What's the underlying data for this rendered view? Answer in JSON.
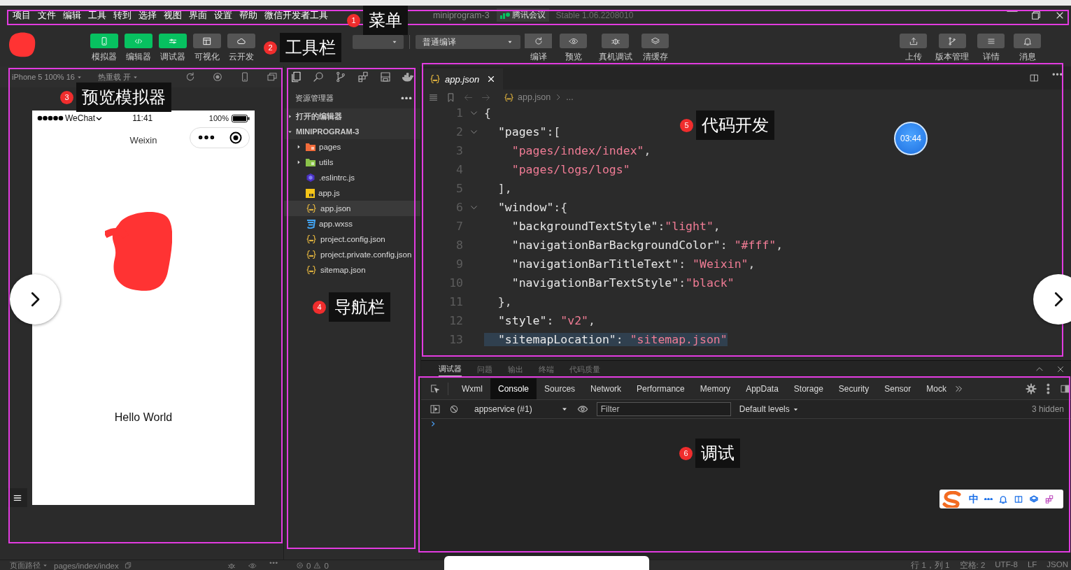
{
  "menu_bar": {
    "items": [
      "项目",
      "文件",
      "编辑",
      "工具",
      "转到",
      "选择",
      "视图",
      "界面",
      "设置",
      "帮助",
      "微信开发者工具"
    ],
    "title": "miniprogram-3",
    "overlay_app": "腾讯会议",
    "version": "Stable 1.06.2208010"
  },
  "toolbar": {
    "view_buttons": [
      {
        "label": "模拟器",
        "on": true,
        "kind": "phone"
      },
      {
        "label": "编辑器",
        "on": true,
        "kind": "code"
      },
      {
        "label": "调试器",
        "on": true,
        "kind": "sliders"
      },
      {
        "label": "可视化",
        "on": false,
        "kind": "layout"
      },
      {
        "label": "云开发",
        "on": false,
        "kind": "cloud"
      }
    ],
    "compile_mode": "普通编译",
    "actions": [
      {
        "label": "编译",
        "kind": "refresh"
      },
      {
        "label": "预览",
        "kind": "eye"
      },
      {
        "label": "真机调试",
        "kind": "bug"
      },
      {
        "label": "清缓存",
        "kind": "layers"
      }
    ],
    "right_actions": [
      {
        "label": "上传",
        "kind": "upload"
      },
      {
        "label": "版本管理",
        "kind": "branch"
      },
      {
        "label": "详情",
        "kind": "menu"
      },
      {
        "label": "消息",
        "kind": "bell"
      }
    ]
  },
  "simulator": {
    "device": "iPhone 5 100% 16",
    "hot_reload": "热重载 开",
    "carrier": "WeChat",
    "time": "11:41",
    "battery": "100%",
    "nav_title": "Weixin",
    "body_text": "Hello World"
  },
  "explorer": {
    "title": "资源管理器",
    "sections": [
      {
        "label": "打开的编辑器",
        "expanded": false
      },
      {
        "label": "MINIPROGRAM-3",
        "expanded": true,
        "children": [
          {
            "name": "pages",
            "kind": "folder",
            "color": "#f26b3a",
            "expanded": false,
            "selected": false
          },
          {
            "name": "utils",
            "kind": "folder",
            "color": "#8bc34a",
            "expanded": false,
            "selected": false
          },
          {
            "name": ".eslintrc.js",
            "kind": "eslint",
            "selected": false
          },
          {
            "name": "app.js",
            "kind": "js",
            "selected": false
          },
          {
            "name": "app.json",
            "kind": "json",
            "selected": true
          },
          {
            "name": "app.wxss",
            "kind": "wxss",
            "selected": false
          },
          {
            "name": "project.config.json",
            "kind": "json",
            "selected": false
          },
          {
            "name": "project.private.config.json",
            "kind": "json",
            "selected": false
          },
          {
            "name": "sitemap.json",
            "kind": "json",
            "selected": false
          }
        ]
      }
    ]
  },
  "editor": {
    "tab": "app.json",
    "breadcrumb": "app.json",
    "breadcrumb_more": "...",
    "timer": "03:44",
    "lines": [
      {
        "number": "1",
        "text": "{",
        "foldable": true,
        "highlighted": false
      },
      {
        "number": "2",
        "text": "  \"pages\":[",
        "foldable": true,
        "highlighted": false
      },
      {
        "number": "3",
        "text": "    \"pages/index/index\",",
        "foldable": false,
        "highlighted": false
      },
      {
        "number": "4",
        "text": "    \"pages/logs/logs\"",
        "foldable": false,
        "highlighted": false
      },
      {
        "number": "5",
        "text": "  ],",
        "foldable": false,
        "highlighted": false
      },
      {
        "number": "6",
        "text": "  \"window\":{",
        "foldable": true,
        "highlighted": false
      },
      {
        "number": "7",
        "text": "    \"backgroundTextStyle\":\"light\",",
        "foldable": false,
        "highlighted": false
      },
      {
        "number": "8",
        "text": "    \"navigationBarBackgroundColor\": \"#fff\",",
        "foldable": false,
        "highlighted": false
      },
      {
        "number": "9",
        "text": "    \"navigationBarTitleText\": \"Weixin\",",
        "foldable": false,
        "highlighted": false
      },
      {
        "number": "10",
        "text": "    \"navigationBarTextStyle\":\"black\"",
        "foldable": false,
        "highlighted": false
      },
      {
        "number": "11",
        "text": "  },",
        "foldable": false,
        "highlighted": false
      },
      {
        "number": "12",
        "text": "  \"style\": \"v2\",",
        "foldable": false,
        "highlighted": false
      },
      {
        "number": "13",
        "text": "  \"sitemapLocation\": \"sitemap.json\"",
        "foldable": false,
        "highlighted": true
      }
    ]
  },
  "debugger": {
    "panel_tabs": [
      {
        "label": "调试器",
        "selected": true
      },
      {
        "label": "问题",
        "selected": false
      },
      {
        "label": "输出",
        "selected": false
      },
      {
        "label": "终端",
        "selected": false
      },
      {
        "label": "代码质量",
        "selected": false
      }
    ],
    "devtools_tabs": [
      {
        "label": "Wxml",
        "selected": false
      },
      {
        "label": "Console",
        "selected": true
      },
      {
        "label": "Sources",
        "selected": false
      },
      {
        "label": "Network",
        "selected": false
      },
      {
        "label": "Performance",
        "selected": false
      },
      {
        "label": "Memory",
        "selected": false
      },
      {
        "label": "AppData",
        "selected": false
      },
      {
        "label": "Storage",
        "selected": false
      },
      {
        "label": "Security",
        "selected": false
      },
      {
        "label": "Sensor",
        "selected": false
      },
      {
        "label": "Mock",
        "selected": false
      }
    ],
    "context": "appservice (#1)",
    "filter_placeholder": "Filter",
    "levels": "Default levels",
    "hidden_count": "3 hidden"
  },
  "ime": {
    "mode": "中"
  },
  "status_bar": {
    "page_path_label": "页面路径",
    "page_path": "pages/index/index",
    "errors": "0",
    "warnings": "0",
    "position": "行 1，列 1",
    "indent": "空格: 2",
    "encoding": "UTF-8",
    "eol": "LF",
    "language": "JSON"
  },
  "annotations": [
    {
      "number": "1",
      "label": "菜单"
    },
    {
      "number": "2",
      "label": "工具栏"
    },
    {
      "number": "3",
      "label": "预览模拟器"
    },
    {
      "number": "4",
      "label": "导航栏"
    },
    {
      "number": "5",
      "label": "代码开发"
    },
    {
      "number": "6",
      "label": "调试"
    }
  ]
}
